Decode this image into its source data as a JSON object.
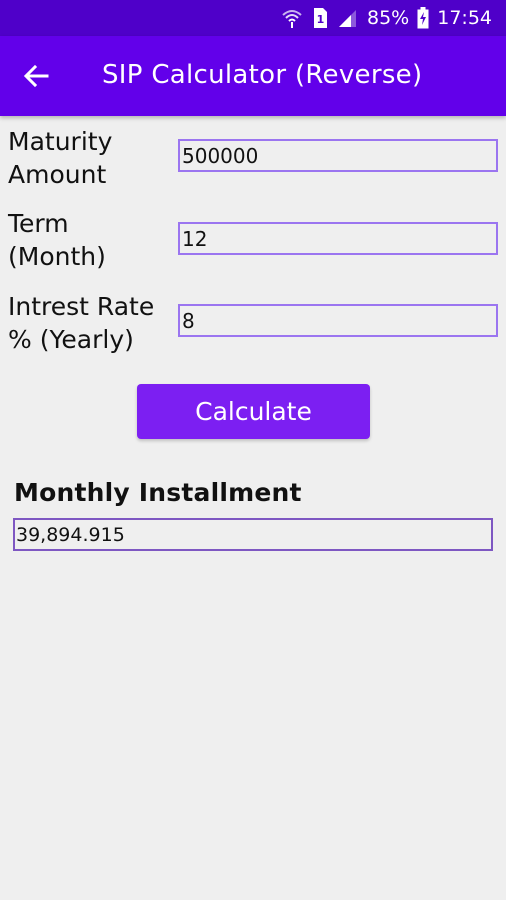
{
  "status_bar": {
    "battery": "85%",
    "time": "17:54",
    "sim_slot": "1",
    "icons": [
      "wifi-icon",
      "sim-icon",
      "signal-icon",
      "battery-charging-icon"
    ]
  },
  "app_bar": {
    "back_icon": "arrow-left-icon",
    "title": "SIP Calculator (Reverse)"
  },
  "form": {
    "maturity_label_line1": "Maturity",
    "maturity_label_line2": "Amount",
    "maturity_value": "500000",
    "term_label_line1": "Term",
    "term_label_line2": "(Month)",
    "term_value": "12",
    "rate_label_line1": "Intrest Rate",
    "rate_label_line2": "% (Yearly)",
    "rate_value": "8"
  },
  "calculate_label": "Calculate",
  "result": {
    "label": "Monthly Installment",
    "value": "39,894.915"
  },
  "colors": {
    "status_bar": "#4f00c9",
    "app_bar": "#6200ea",
    "button": "#7c1ff2",
    "field_border": "#9b75f0",
    "background": "#efefef"
  }
}
